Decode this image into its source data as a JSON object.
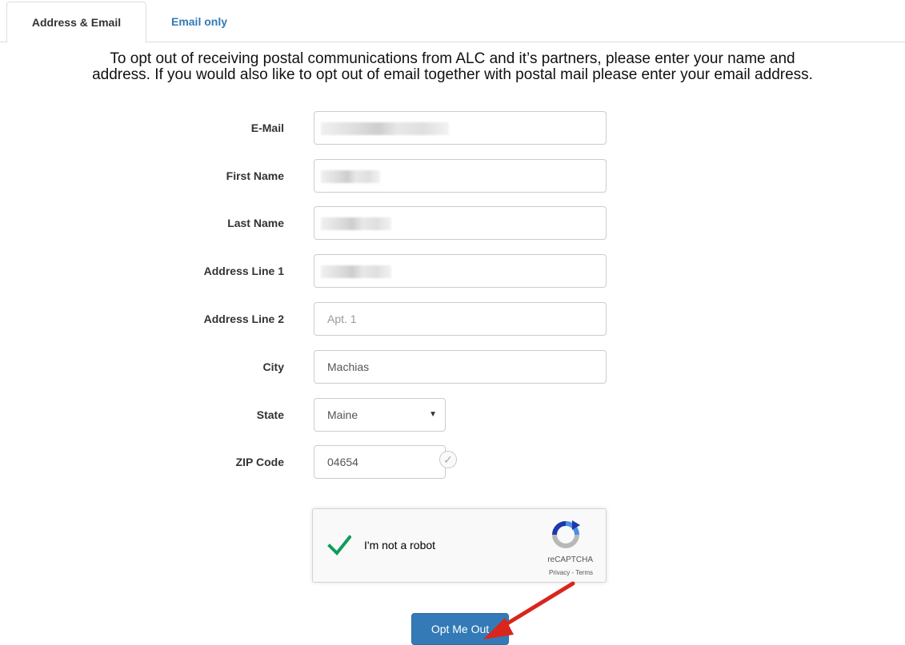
{
  "tabs": [
    {
      "label": "Address & Email",
      "active": true
    },
    {
      "label": "Email only",
      "active": false
    }
  ],
  "intro": {
    "line1": "To opt out of receiving postal communications from ALC and it’s partners, please enter your name and",
    "line2": "address. If you would also like to opt out of email together with postal mail please enter your email address."
  },
  "form": {
    "email": {
      "label": "E-Mail",
      "value": ""
    },
    "first_name": {
      "label": "First Name",
      "value": ""
    },
    "last_name": {
      "label": "Last Name",
      "value": ""
    },
    "address1": {
      "label": "Address Line 1",
      "value": ""
    },
    "address2": {
      "label": "Address Line 2",
      "placeholder": "Apt. 1"
    },
    "city": {
      "label": "City",
      "value": "Machias"
    },
    "state": {
      "label": "State",
      "value": "Maine"
    },
    "zip": {
      "label": "ZIP Code",
      "value": "04654"
    }
  },
  "recaptcha": {
    "label": "I'm not a robot",
    "brand": "reCAPTCHA",
    "links": "Privacy - Terms"
  },
  "submit": {
    "label": "Opt Me Out"
  },
  "colors": {
    "link": "#337ab7",
    "button": "#337ab7",
    "check": "#0f9d58",
    "arrow": "#d9261c"
  }
}
